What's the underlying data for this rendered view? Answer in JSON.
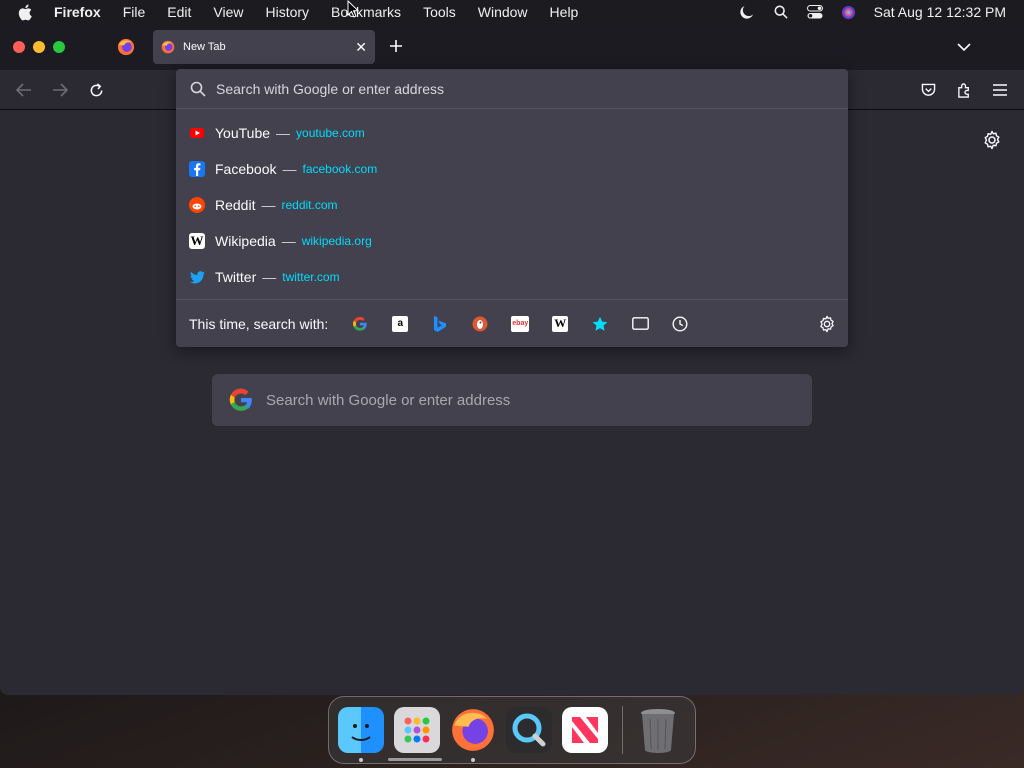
{
  "menubar": {
    "app_name": "Firefox",
    "items": [
      "File",
      "Edit",
      "View",
      "History",
      "Bookmarks",
      "Tools",
      "Window",
      "Help"
    ],
    "clock": "Sat Aug 12  12:32 PM"
  },
  "tabs": {
    "active_title": "New Tab"
  },
  "urlbar": {
    "placeholder": "Search with Google or enter address",
    "results": [
      {
        "name": "YouTube",
        "url": "youtube.com",
        "icon": "youtube-icon",
        "color": "#ff0000"
      },
      {
        "name": "Facebook",
        "url": "facebook.com",
        "icon": "facebook-icon",
        "color": "#1877f2"
      },
      {
        "name": "Reddit",
        "url": "reddit.com",
        "icon": "reddit-icon",
        "color": "#ff4500"
      },
      {
        "name": "Wikipedia",
        "url": "wikipedia.org",
        "icon": "wikipedia-icon",
        "color": "#ffffff"
      },
      {
        "name": "Twitter",
        "url": "twitter.com",
        "icon": "twitter-icon",
        "color": "#1da1f2"
      }
    ],
    "dash": "—",
    "oneoff_label": "This time, search with:",
    "engines": [
      "google-icon",
      "amazon-icon",
      "bing-icon",
      "duckduckgo-icon",
      "ebay-icon",
      "wikipedia-icon",
      "bookmarks-icon",
      "tabs-icon",
      "history-icon"
    ]
  },
  "newtab": {
    "search_placeholder": "Search with Google or enter address"
  },
  "colors": {
    "accent_link": "#00ddff",
    "popup_bg": "#42414d",
    "content_bg": "#2b2a33"
  },
  "dock": {
    "apps": [
      "finder-icon",
      "launchpad-icon",
      "firefox-icon",
      "quicktime-icon",
      "news-icon",
      "trash-icon"
    ]
  }
}
